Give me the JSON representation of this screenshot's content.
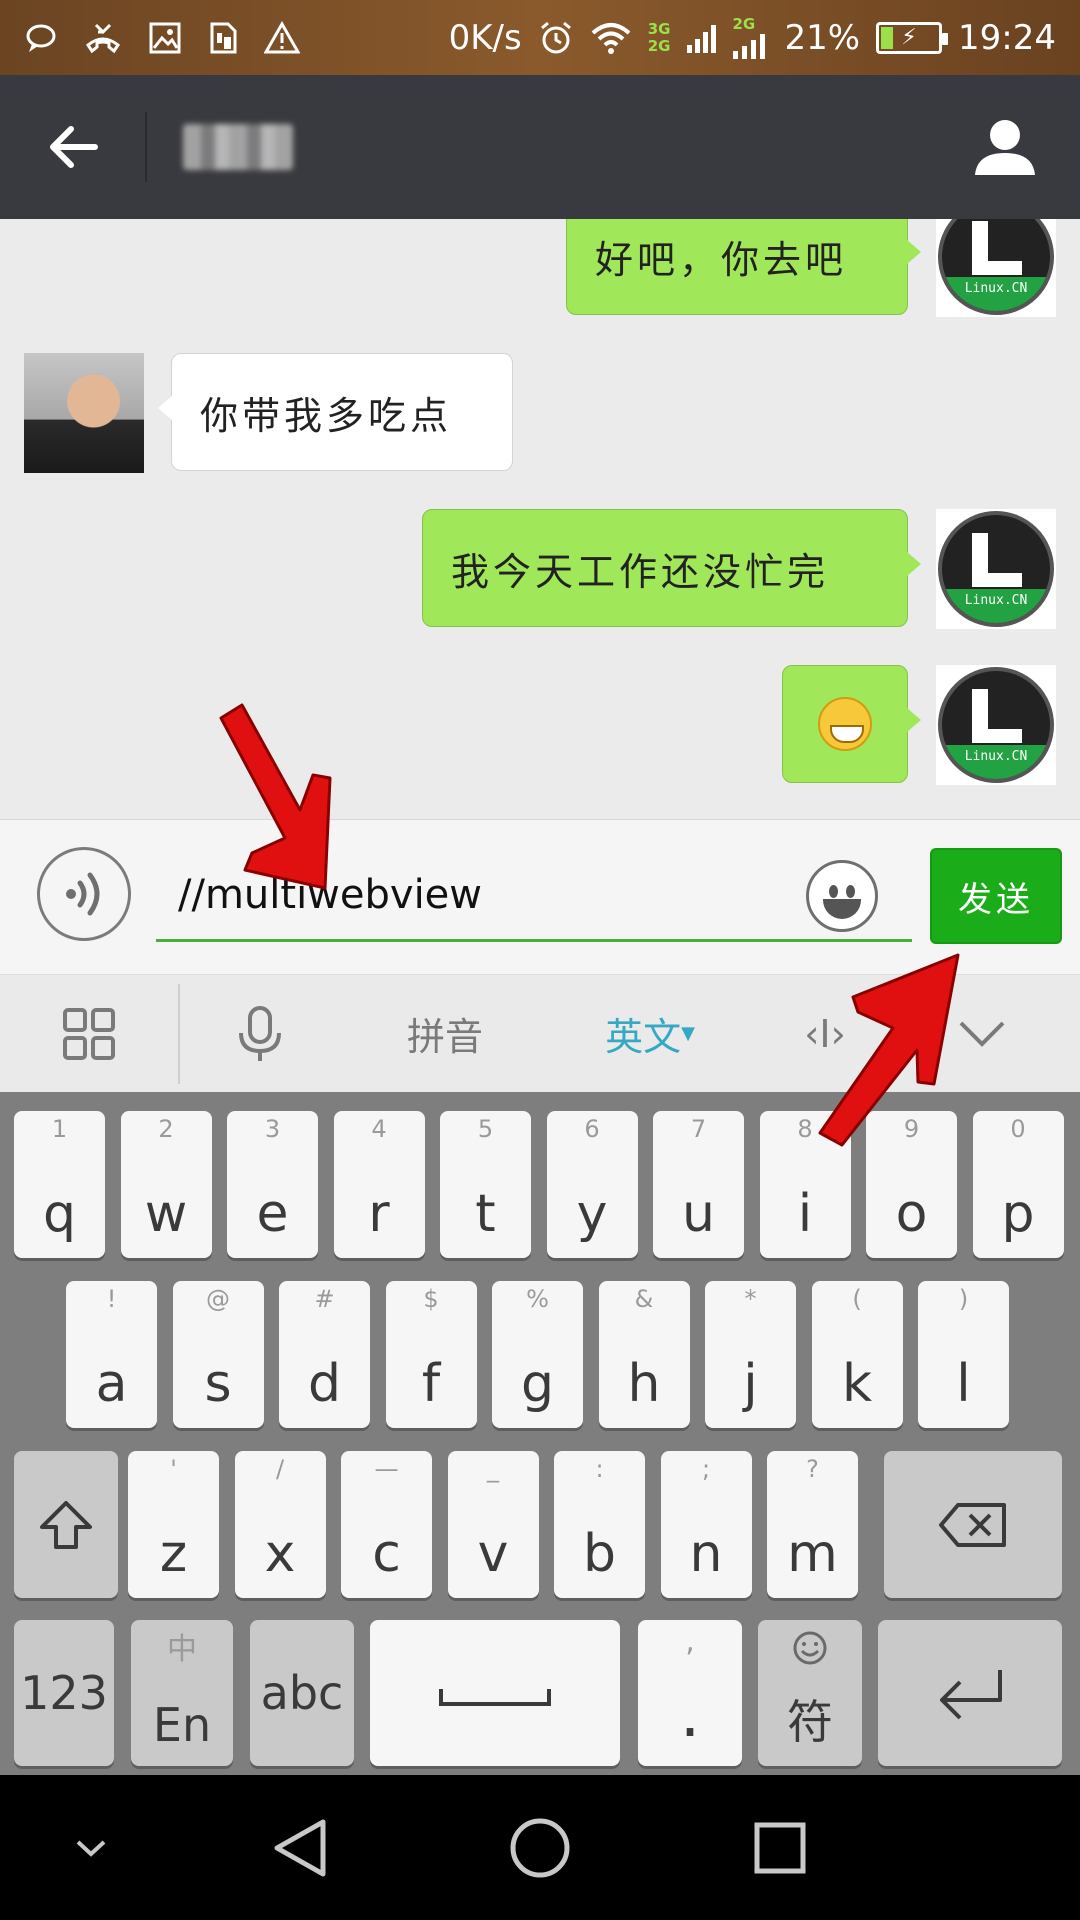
{
  "status_bar": {
    "speed": "0K/s",
    "net_top": "3G",
    "net_bottom": "2G",
    "net2": "2G",
    "battery_text": "21%",
    "battery_level": 0.21,
    "time": "19:24"
  },
  "header": {
    "contact_name": ""
  },
  "chat": {
    "messages": [
      {
        "side": "me",
        "text": "好吧，你去吧"
      },
      {
        "side": "them",
        "text": "你带我多吃点"
      },
      {
        "side": "me",
        "text": "我今天工作还没忙完"
      },
      {
        "side": "me",
        "text": "",
        "emoji": "grinning-emoji"
      }
    ],
    "my_avatar_text": "Linux.CN"
  },
  "input": {
    "value": "//multiwebview",
    "send_label": "发送"
  },
  "ime_toolbar": {
    "pinyin": "拼音",
    "english": "英文",
    "cursor": "‹I›"
  },
  "keyboard": {
    "row1": [
      {
        "hint": "1",
        "key": "q"
      },
      {
        "hint": "2",
        "key": "w"
      },
      {
        "hint": "3",
        "key": "e"
      },
      {
        "hint": "4",
        "key": "r"
      },
      {
        "hint": "5",
        "key": "t"
      },
      {
        "hint": "6",
        "key": "y"
      },
      {
        "hint": "7",
        "key": "u"
      },
      {
        "hint": "8",
        "key": "i"
      },
      {
        "hint": "9",
        "key": "o"
      },
      {
        "hint": "0",
        "key": "p"
      }
    ],
    "row2": [
      {
        "hint": "!",
        "key": "a"
      },
      {
        "hint": "@",
        "key": "s"
      },
      {
        "hint": "#",
        "key": "d"
      },
      {
        "hint": "$",
        "key": "f"
      },
      {
        "hint": "%",
        "key": "g"
      },
      {
        "hint": "&",
        "key": "h"
      },
      {
        "hint": "*",
        "key": "j"
      },
      {
        "hint": "(",
        "key": "k"
      },
      {
        "hint": ")",
        "key": "l"
      }
    ],
    "row3": [
      {
        "hint": "'",
        "key": "z"
      },
      {
        "hint": "/",
        "key": "x"
      },
      {
        "hint": "—",
        "key": "c"
      },
      {
        "hint": "_",
        "key": "v"
      },
      {
        "hint": ":",
        "key": "b"
      },
      {
        "hint": ";",
        "key": "n"
      },
      {
        "hint": "?",
        "key": "m"
      }
    ],
    "num_label": "123",
    "lang_hint": "中",
    "lang_label": "En",
    "abc_label": "abc",
    "comma_hint": ",",
    "period_label": ".",
    "symbol_label": "符"
  },
  "colors": {
    "header": "#393a3f",
    "bubble_mine": "#a0e75a",
    "send_button": "#1aad19",
    "input_underline": "#4aad3a",
    "ime_active": "#35a9c4",
    "annotation_arrow": "#e01010"
  }
}
